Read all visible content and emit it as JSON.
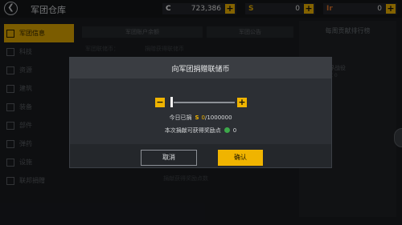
{
  "header": {
    "title": "军团仓库",
    "back_icon": "arrow-left-icon",
    "resources": [
      {
        "icon_text": "C",
        "icon_color": "#ffffff",
        "value": "723,386",
        "add": "+"
      },
      {
        "icon_text": "S",
        "icon_color": "#f0b400",
        "value": "0",
        "add": "+"
      },
      {
        "icon_text": "Ir",
        "icon_color": "#e0752a",
        "value": "0",
        "add": "+"
      }
    ]
  },
  "sidebar": {
    "items": [
      {
        "label": "军团信息",
        "active": true
      },
      {
        "label": "科技"
      },
      {
        "label": "资源"
      },
      {
        "label": "建筑"
      },
      {
        "label": "装备"
      },
      {
        "label": "部件"
      },
      {
        "label": "弹药"
      },
      {
        "label": "设施"
      },
      {
        "label": "联邦捐赠"
      }
    ]
  },
  "background": {
    "tab_account": "军团账户余额",
    "tab_notice": "军团公告",
    "currency_label": "军团联储币：",
    "donate_hint": "捐赠获得联储币",
    "footer_text": "捐献获得奖励点数",
    "rank_title": "每周贡献排行榜",
    "rank_name": "世界战役",
    "rank_sub": "贡献 0"
  },
  "dialog": {
    "title": "向军团捐赠联储币",
    "minus": "−",
    "plus": "+",
    "slider_value": 0,
    "today_label": "今日已捐",
    "today_current": "0",
    "today_limit": "/1000000",
    "reward_label": "本次捐献可获得奖励点",
    "reward_value": "0",
    "cancel": "取消",
    "confirm": "确认"
  },
  "colors": {
    "accent": "#f0b400",
    "panel": "#2c2f34",
    "header": "#3a3d42"
  }
}
